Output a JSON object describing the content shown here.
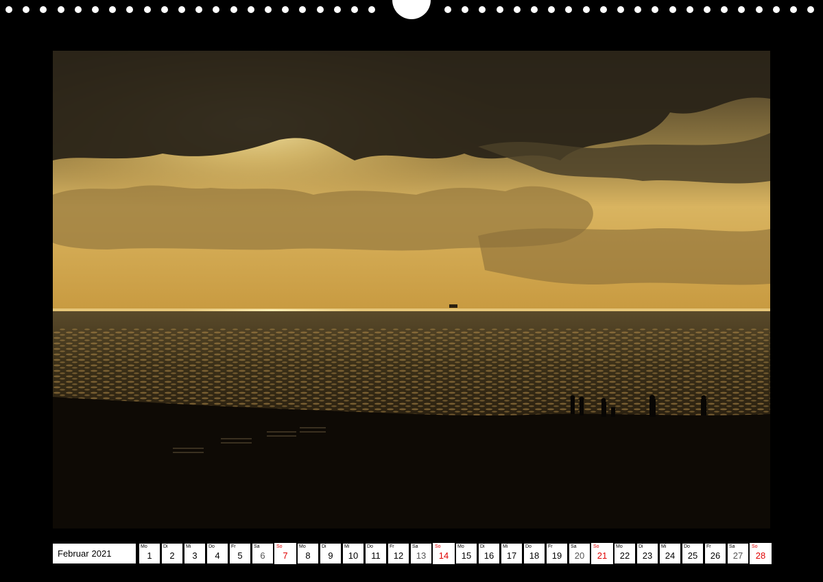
{
  "calendar": {
    "month": "Februar",
    "year": "2021",
    "days": [
      {
        "wd": "Mo",
        "d": "1",
        "type": "wd"
      },
      {
        "wd": "Di",
        "d": "2",
        "type": "wd"
      },
      {
        "wd": "Mi",
        "d": "3",
        "type": "wd"
      },
      {
        "wd": "Do",
        "d": "4",
        "type": "wd"
      },
      {
        "wd": "Fr",
        "d": "5",
        "type": "wd"
      },
      {
        "wd": "Sa",
        "d": "6",
        "type": "sat"
      },
      {
        "wd": "So",
        "d": "7",
        "type": "sun"
      },
      {
        "wd": "Mo",
        "d": "8",
        "type": "wd"
      },
      {
        "wd": "Di",
        "d": "9",
        "type": "wd"
      },
      {
        "wd": "Mi",
        "d": "10",
        "type": "wd"
      },
      {
        "wd": "Do",
        "d": "11",
        "type": "wd"
      },
      {
        "wd": "Fr",
        "d": "12",
        "type": "wd"
      },
      {
        "wd": "Sa",
        "d": "13",
        "type": "sat"
      },
      {
        "wd": "So",
        "d": "14",
        "type": "sun"
      },
      {
        "wd": "Mo",
        "d": "15",
        "type": "wd"
      },
      {
        "wd": "Di",
        "d": "16",
        "type": "wd"
      },
      {
        "wd": "Mi",
        "d": "17",
        "type": "wd"
      },
      {
        "wd": "Do",
        "d": "18",
        "type": "wd"
      },
      {
        "wd": "Fr",
        "d": "19",
        "type": "wd"
      },
      {
        "wd": "Sa",
        "d": "20",
        "type": "sat"
      },
      {
        "wd": "So",
        "d": "21",
        "type": "sun"
      },
      {
        "wd": "Mo",
        "d": "22",
        "type": "wd"
      },
      {
        "wd": "Di",
        "d": "23",
        "type": "wd"
      },
      {
        "wd": "Mi",
        "d": "24",
        "type": "wd"
      },
      {
        "wd": "Do",
        "d": "25",
        "type": "wd"
      },
      {
        "wd": "Fr",
        "d": "26",
        "type": "wd"
      },
      {
        "wd": "Sa",
        "d": "27",
        "type": "sat"
      },
      {
        "wd": "So",
        "d": "28",
        "type": "sun"
      }
    ]
  },
  "colors": {
    "background": "#000000",
    "sunday": "#e00000"
  },
  "photo": {
    "icon": "sunset-over-sea-photo"
  }
}
